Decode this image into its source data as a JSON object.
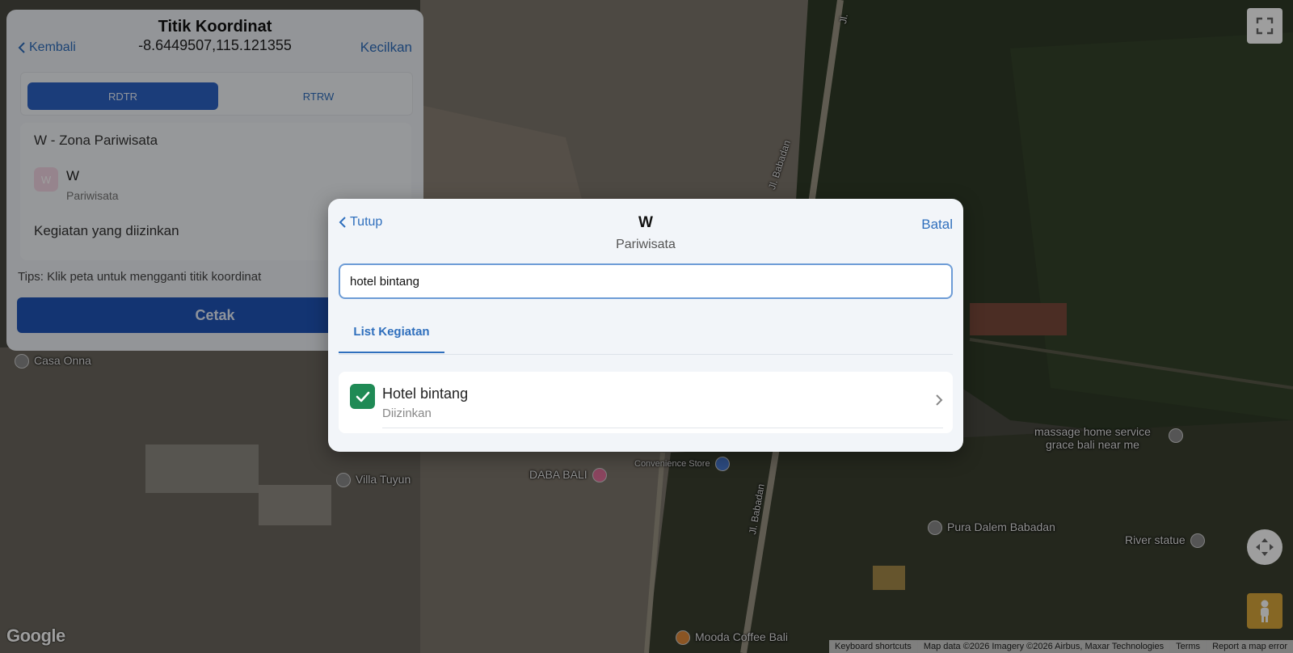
{
  "panel": {
    "back_label": "Kembali",
    "title": "Titik Koordinat",
    "coordinates": "-8.6449507,115.121355",
    "minimize_label": "Kecilkan",
    "tabs": [
      {
        "label": "RDTR",
        "active": true
      },
      {
        "label": "RTRW",
        "active": false
      }
    ],
    "zona_title": "W - Zona Pariwisata",
    "zona_code": "W",
    "zona_name": "Pariwisata",
    "kegiatan_label": "Kegiatan yang diizinkan",
    "tips": "Tips: Klik peta untuk mengganti titik koordinat",
    "print_label": "Cetak"
  },
  "modal": {
    "close_label": "Tutup",
    "title": "W",
    "subtitle": "Pariwisata",
    "cancel_label": "Batal",
    "search_value": "hotel bintang",
    "tab_label": "List Kegiatan",
    "items": [
      {
        "title": "Hotel bintang",
        "status": "Diizinkan",
        "checked": true
      }
    ]
  },
  "map": {
    "labels": {
      "casa_onna": "Casa Onna",
      "villa_tuyun": "Villa Tuyun",
      "daba_bali": "DABA BALI",
      "convenience": "Convenience Store",
      "massage": "massage home service",
      "massage2": "grace bali near me",
      "pura": "Pura Dalem Babadan",
      "river": "River statue",
      "mooda": "Mooda Coffee Bali",
      "road1": "Jl. Babadan",
      "road2": "Jl. Babadan",
      "road3": "Jl."
    },
    "google": "Google",
    "footer": {
      "shortcuts": "Keyboard shortcuts",
      "data": "Map data ©2026 Imagery ©2026 Airbus, Maxar Technologies",
      "terms": "Terms",
      "report": "Report a map error"
    }
  },
  "colors": {
    "accent": "#2f6fbd",
    "primary_button": "#1f54b8",
    "check_green": "#1f8a55"
  }
}
